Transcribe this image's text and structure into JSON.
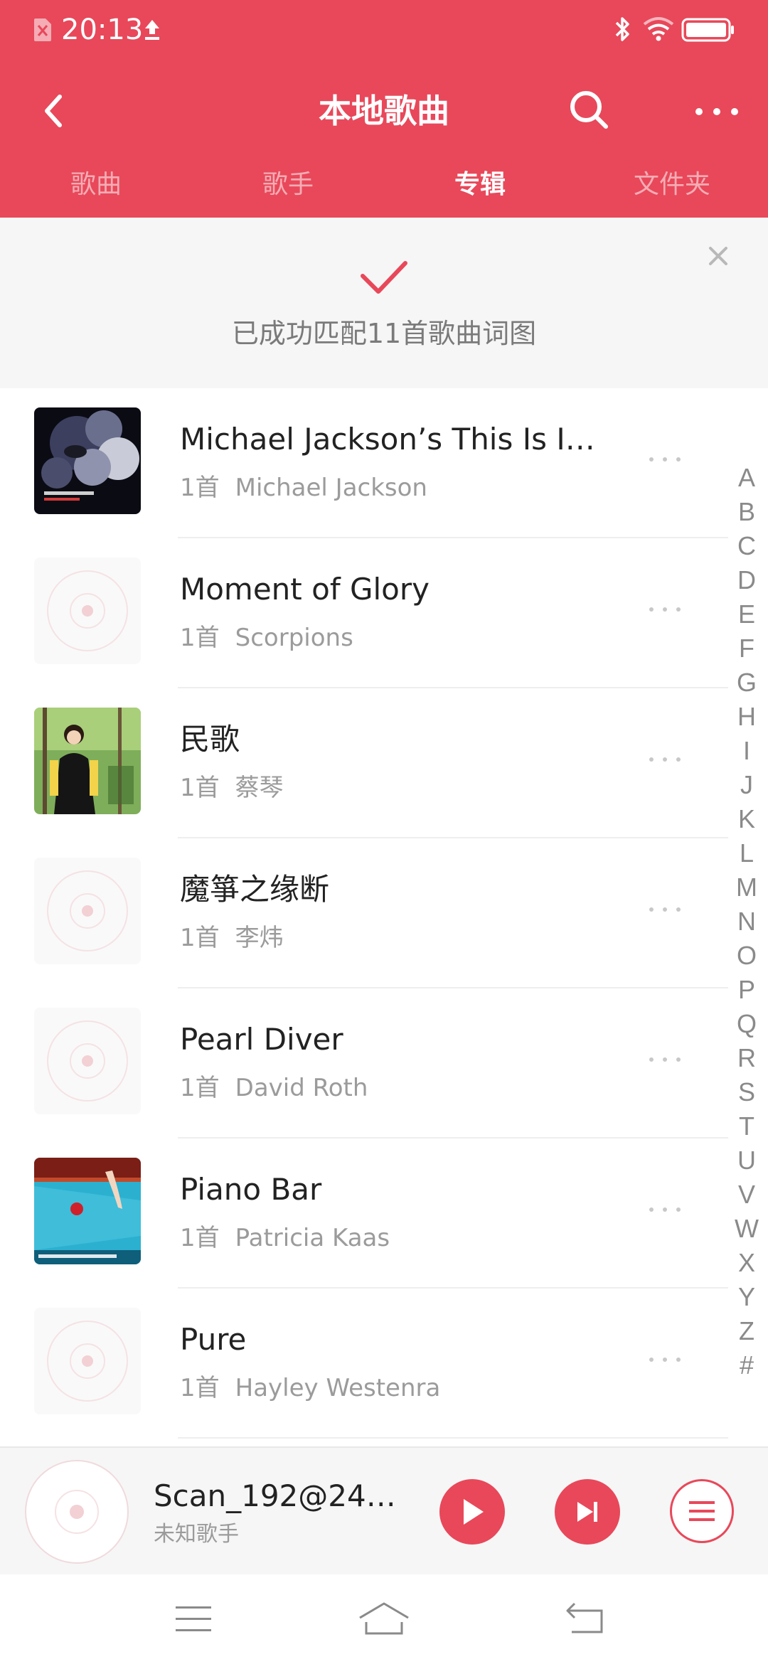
{
  "status_bar": {
    "time": "20:13",
    "icons": [
      "sim-off-icon",
      "upload-icon",
      "bluetooth-icon",
      "wifi-icon",
      "battery-icon"
    ]
  },
  "header": {
    "title": "本地歌曲",
    "back_icon": "back-arrow-icon",
    "search_icon": "search-icon",
    "more_icon": "more-dots-icon",
    "tabs": [
      {
        "label": "歌曲",
        "active": false
      },
      {
        "label": "歌手",
        "active": false
      },
      {
        "label": "专辑",
        "active": true
      },
      {
        "label": "文件夹",
        "active": false
      }
    ]
  },
  "banner": {
    "message": "已成功匹配11首歌曲词图",
    "icon": "check-icon",
    "close_icon": "close-icon"
  },
  "albums": [
    {
      "title": "Michael Jackson’s This Is It…",
      "count": "1首",
      "artist": "Michael Jackson",
      "cover": "michael-jackson-cover"
    },
    {
      "title": "Moment of Glory",
      "count": "1首",
      "artist": "Scorpions",
      "cover": "default-disc-cover"
    },
    {
      "title": "民歌",
      "count": "1首",
      "artist": "蔡琴",
      "cover": "minge-cover"
    },
    {
      "title": "魔箏之缘断",
      "count": "1首",
      "artist": "李炜",
      "cover": "default-disc-cover"
    },
    {
      "title": "Pearl Diver",
      "count": "1首",
      "artist": "David Roth",
      "cover": "default-disc-cover"
    },
    {
      "title": "Piano Bar",
      "count": "1首",
      "artist": "Patricia Kaas",
      "cover": "piano-bar-cover"
    },
    {
      "title": "Pure",
      "count": "1首",
      "artist": "Hayley Westenra",
      "cover": "default-disc-cover"
    }
  ],
  "alphabet_index": [
    "A",
    "B",
    "C",
    "D",
    "E",
    "F",
    "G",
    "H",
    "I",
    "J",
    "K",
    "L",
    "M",
    "N",
    "O",
    "P",
    "Q",
    "R",
    "S",
    "T",
    "U",
    "V",
    "W",
    "X",
    "Y",
    "Z",
    "#"
  ],
  "player": {
    "title": "Scan_192@24bi…",
    "artist": "未知歌手",
    "play_icon": "play-icon",
    "next_icon": "next-track-icon",
    "queue_icon": "playlist-icon"
  },
  "navbar": {
    "icons": [
      "menu-icon",
      "home-icon",
      "back-icon"
    ]
  },
  "colors": {
    "accent": "#e8485a",
    "banner_bg": "#f6f6f6",
    "text_primary": "#222222",
    "text_secondary": "#9b9b9b"
  }
}
